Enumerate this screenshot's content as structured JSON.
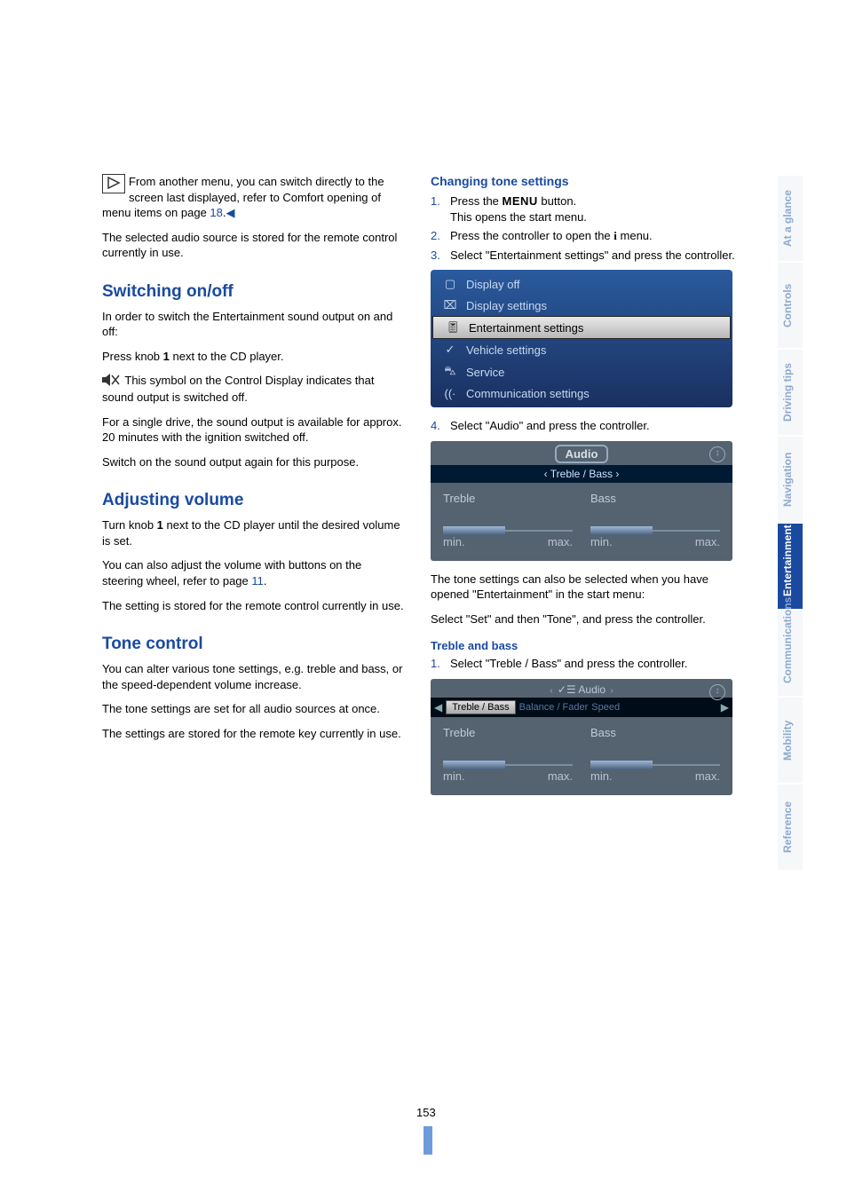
{
  "tip_box": {
    "text_before": "From another menu, you can switch directly to the screen last displayed, refer to Comfort opening of menu items on page ",
    "page_ref": "18",
    "text_after": "."
  },
  "left": {
    "p_stored": "The selected audio source is stored for the remote control currently in use.",
    "h_switch": "Switching on/off",
    "p_switch1": "In order to switch the Entertainment sound output on and off:",
    "p_switch2_a": "Press knob ",
    "knob_bold": "1",
    "p_switch2_b": " next to the CD player.",
    "p_muteicon": " This symbol on the Control Display indicates that sound output is switched off.",
    "p_single1": "For a single drive, the sound output is available for approx. 20 minutes with the ignition switched off.",
    "p_single2": "Switch on the sound output again for this purpose.",
    "h_volume": "Adjusting volume",
    "p_vol1_a": "Turn knob ",
    "p_vol1_b": " next to the CD player until the desired volume is set.",
    "p_vol2_a": "You can also adjust the volume with buttons on the steering wheel, refer to page ",
    "p_vol2_ref": "11",
    "p_vol2_b": ".",
    "p_vol3": "The setting is stored for the remote control currently in use.",
    "h_tone": "Tone control",
    "p_tone1": "You can alter various tone settings, e.g. treble and bass, or the speed-dependent volume increase.",
    "p_tone2": "The tone settings are set for all audio sources at once.",
    "p_tone3": "The settings are stored for the remote key currently in use."
  },
  "right": {
    "h_change": "Changing tone settings",
    "step1_a": "Press the ",
    "menu_word": "MENU",
    "step1_b": " button.",
    "step1_sub": "This opens the start menu.",
    "step2_a": "Press the controller to open the ",
    "step2_b": " menu.",
    "step3": "Select \"Entertainment settings\" and press the controller.",
    "step4": "Select \"Audio\" and press the controller.",
    "p_after1": "The tone settings can also be selected when you have opened \"Entertainment\" in the start menu:",
    "p_after2": "Select \"Set\" and then \"Tone\", and press the controller.",
    "h_treble": "Treble and bass",
    "trb_step1": "Select \"Treble / Bass\" and press the controller."
  },
  "idrive_menu": {
    "items": [
      "Display off",
      "Display settings",
      "Entertainment settings",
      "Vehicle settings",
      "Service",
      "Communication settings"
    ]
  },
  "audio1": {
    "title": "Audio",
    "banner_left": "‹",
    "banner_text": "Treble / Bass",
    "banner_right": "›",
    "label_treble": "Treble",
    "label_bass": "Bass",
    "min": "min.",
    "max": "max."
  },
  "audio2": {
    "nav_left": "‹",
    "nav_icon": "✓☰",
    "nav_title": "Audio",
    "nav_right": "›",
    "chip1": "Treble / Bass",
    "chip2": "Balance / Fader",
    "chip3": "Speed",
    "label_treble": "Treble",
    "label_bass": "Bass",
    "min": "min.",
    "max": "max."
  },
  "tabs": [
    "At a glance",
    "Controls",
    "Driving tips",
    "Navigation",
    "Entertainment",
    "Communications",
    "Mobility",
    "Reference"
  ],
  "page_number": "153"
}
